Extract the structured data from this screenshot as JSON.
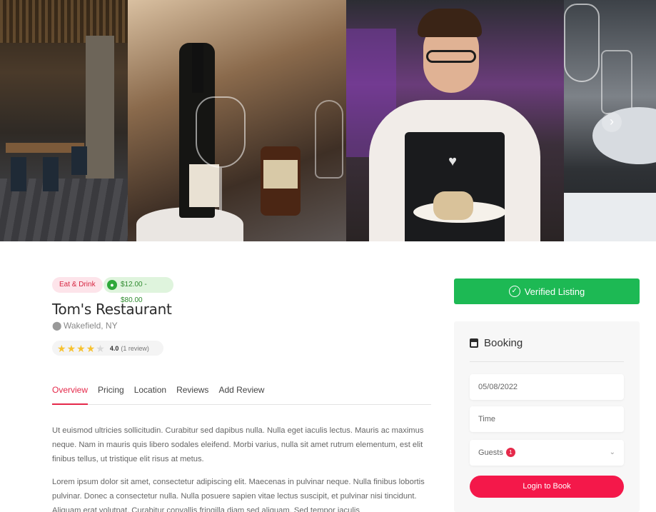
{
  "listing": {
    "category": "Eat & Drink",
    "price_range": "$12.00 - $80.00",
    "title": "Tom's Restaurant",
    "location": "Wakefield, NY",
    "rating": 4.0,
    "rating_value": "4.0",
    "review_count": "(1 review)"
  },
  "tabs": [
    "Overview",
    "Pricing",
    "Location",
    "Reviews",
    "Add Review"
  ],
  "active_tab": "Overview",
  "overview": {
    "p1": "Ut euismod ultricies sollicitudin. Curabitur sed dapibus nulla. Nulla eget iaculis lectus. Mauris ac maximus neque. Nam in mauris quis libero sodales eleifend. Morbi varius, nulla sit amet rutrum elementum, est elit finibus tellus, ut tristique elit risus at metus.",
    "p2": "Lorem ipsum dolor sit amet, consectetur adipiscing elit. Maecenas in pulvinar neque. Nulla finibus lobortis pulvinar. Donec a consectetur nulla. Nulla posuere sapien vitae lectus suscipit, et pulvinar nisi tincidunt. Aliquam erat volutpat. Curabitur convallis fringilla diam sed aliquam. Sed tempor iaculis"
  },
  "sidebar": {
    "verified_label": "Verified Listing",
    "booking_title": "Booking",
    "date_value": "05/08/2022",
    "time_placeholder": "Time",
    "guests_label": "Guests",
    "guests_count": "1",
    "login_button": "Login to Book"
  },
  "colors": {
    "accent": "#f4184a",
    "verified": "#1db954",
    "star": "#f7c230"
  },
  "icons": [
    "tag-icon",
    "map-pin-icon",
    "star-icon",
    "check-circle-icon",
    "calendar-icon",
    "chevron-down-icon",
    "chevron-right-icon"
  ]
}
